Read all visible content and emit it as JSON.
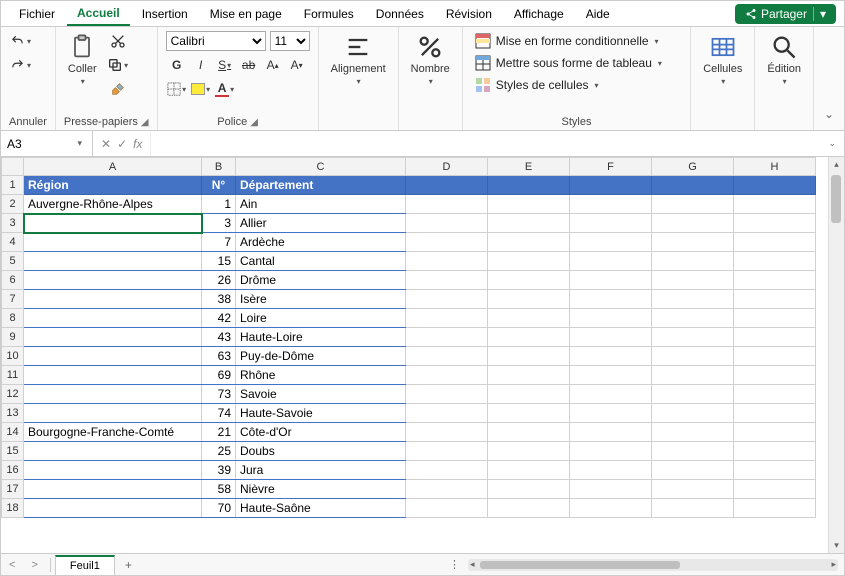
{
  "menu": {
    "items": [
      "Fichier",
      "Accueil",
      "Insertion",
      "Mise en page",
      "Formules",
      "Données",
      "Révision",
      "Affichage",
      "Aide"
    ],
    "active": 1,
    "share": "Partager"
  },
  "ribbon": {
    "annuler": "Annuler",
    "presse": "Presse-papiers",
    "coller": "Coller",
    "police": "Police",
    "font": "Calibri",
    "size": "11",
    "alignement": "Alignement",
    "nombre": "Nombre",
    "styles": "Styles",
    "cond": "Mise en forme conditionnelle",
    "tbl": "Mettre sous forme de tableau",
    "cellstyles": "Styles de cellules",
    "cellules": "Cellules",
    "edition": "Édition"
  },
  "namebox": "A3",
  "cols": [
    "A",
    "B",
    "C",
    "D",
    "E",
    "F",
    "G",
    "H"
  ],
  "headers": {
    "A": "Région",
    "B": "N°",
    "C": "Département"
  },
  "rows": [
    {
      "r": "Auvergne-Rhône-Alpes",
      "n": "1",
      "d": "Ain"
    },
    {
      "r": "",
      "n": "3",
      "d": "Allier"
    },
    {
      "r": "",
      "n": "7",
      "d": "Ardèche"
    },
    {
      "r": "",
      "n": "15",
      "d": "Cantal"
    },
    {
      "r": "",
      "n": "26",
      "d": "Drôme"
    },
    {
      "r": "",
      "n": "38",
      "d": "Isère"
    },
    {
      "r": "",
      "n": "42",
      "d": "Loire"
    },
    {
      "r": "",
      "n": "43",
      "d": "Haute-Loire"
    },
    {
      "r": "",
      "n": "63",
      "d": "Puy-de-Dôme"
    },
    {
      "r": "",
      "n": "69",
      "d": "Rhône"
    },
    {
      "r": "",
      "n": "73",
      "d": "Savoie"
    },
    {
      "r": "",
      "n": "74",
      "d": "Haute-Savoie"
    },
    {
      "r": "Bourgogne-Franche-Comté",
      "n": "21",
      "d": "Côte-d'Or"
    },
    {
      "r": "",
      "n": "25",
      "d": "Doubs"
    },
    {
      "r": "",
      "n": "39",
      "d": "Jura"
    },
    {
      "r": "",
      "n": "58",
      "d": "Nièvre"
    },
    {
      "r": "",
      "n": "70",
      "d": "Haute-Saône"
    }
  ],
  "sheettab": "Feuil1"
}
